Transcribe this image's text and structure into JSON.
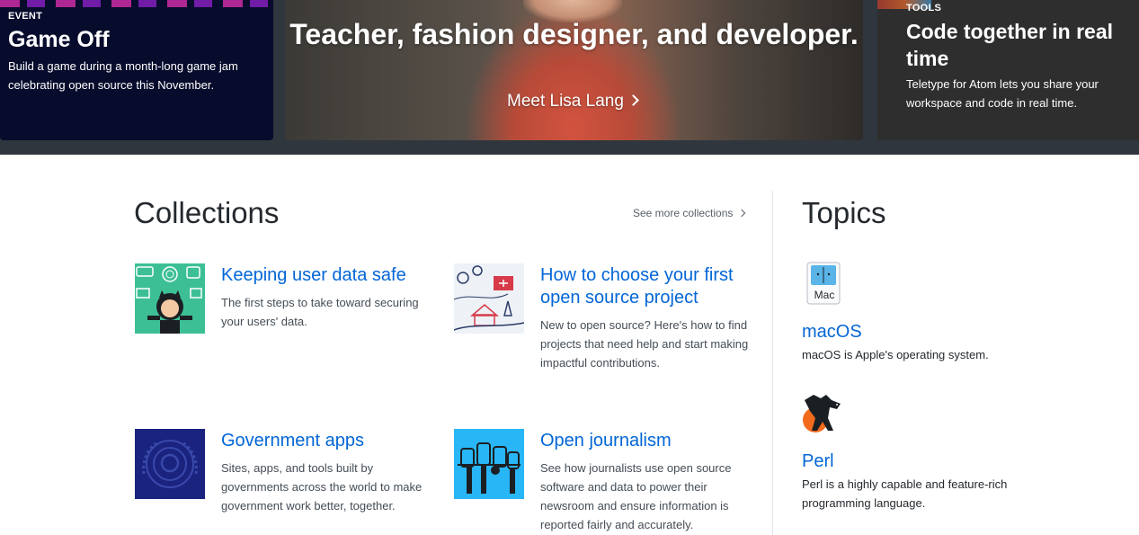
{
  "hero": {
    "left": {
      "eyebrow": "EVENT",
      "title": "Game Off",
      "description": "Build a game during a month-long game jam celebrating open source this November."
    },
    "center": {
      "title": "Teacher, fashion designer, and developer.",
      "link": "Meet Lisa Lang"
    },
    "right": {
      "eyebrow": "TOOLS",
      "title": "Code together in real time",
      "description": "Teletype for Atom lets you share your workspace and code in real time."
    }
  },
  "collections": {
    "heading": "Collections",
    "see_more": "See more collections",
    "items": [
      {
        "title": "Keeping user data safe",
        "description": "The first steps to take toward securing your users' data."
      },
      {
        "title": "How to choose your first open source project",
        "description": "New to open source? Here's how to find projects that need help and start making impactful contributions."
      },
      {
        "title": "Government apps",
        "description": "Sites, apps, and tools built by governments across the world to make government work better, together."
      },
      {
        "title": "Open journalism",
        "description": "See how journalists use open source software and data to power their newsroom and ensure information is reported fairly and accurately."
      }
    ]
  },
  "topics": {
    "heading": "Topics",
    "items": [
      {
        "name": "macOS",
        "description": "macOS is Apple's operating system.",
        "icon": "mac-icon",
        "icon_label": "Mac"
      },
      {
        "name": "Perl",
        "description": "Perl is a highly capable and feature-rich programming language.",
        "icon": "perl-camel-icon"
      }
    ]
  },
  "colors": {
    "link": "#0366d6",
    "text": "#24292e",
    "hero_bg": "#2f363d"
  }
}
